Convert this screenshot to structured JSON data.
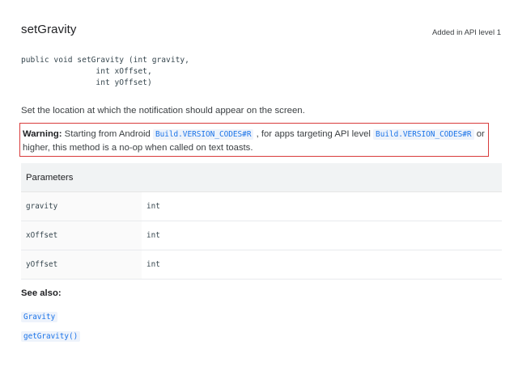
{
  "method": {
    "title": "setGravity",
    "api_level": "Added in API level 1",
    "signature": "public void setGravity (int gravity,\n                int xOffset,\n                int yOffset)",
    "description": "Set the location at which the notification should appear on the screen."
  },
  "warning": {
    "label": "Warning:",
    "text_1": " Starting from Android ",
    "code_1": "Build.VERSION_CODES#R",
    "text_2": " , for apps targeting API level ",
    "code_2": "Build.VERSION_CODES#R",
    "text_3": " or higher, this method is a no-op when called on text toasts."
  },
  "parameters": {
    "header": "Parameters",
    "rows": [
      {
        "name": "gravity",
        "type": "int"
      },
      {
        "name": "xOffset",
        "type": "int"
      },
      {
        "name": "yOffset",
        "type": "int"
      }
    ]
  },
  "see_also": {
    "label": "See also:",
    "links": [
      "Gravity",
      "getGravity()"
    ]
  }
}
